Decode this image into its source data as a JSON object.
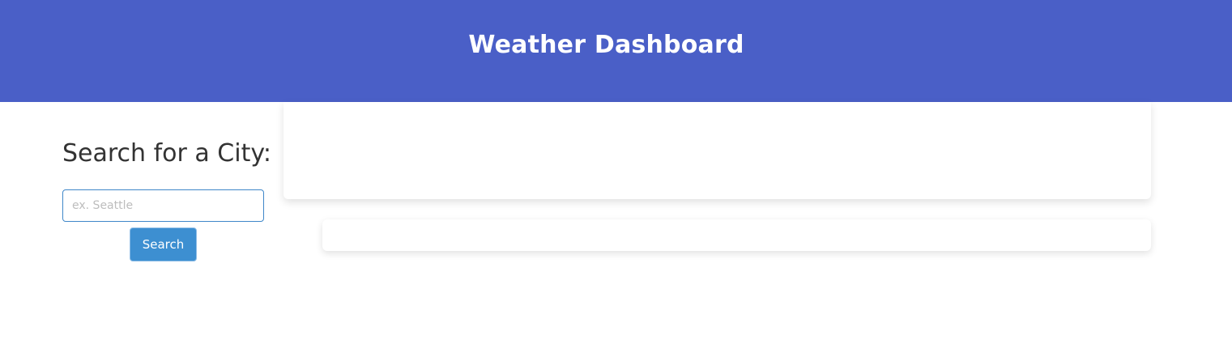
{
  "header": {
    "title": "Weather Dashboard"
  },
  "search": {
    "heading": "Search for a City:",
    "placeholder": "ex. Seattle",
    "value": "",
    "button_label": "Search"
  },
  "colors": {
    "header_bg": "#4a5fc7",
    "button_bg": "#3d8fd1",
    "input_border": "#3f87c9"
  }
}
